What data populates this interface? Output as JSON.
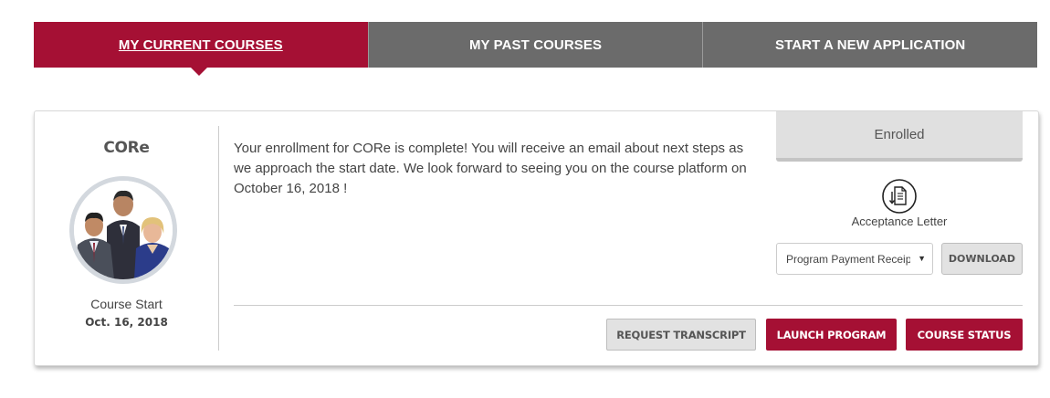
{
  "tabs": [
    {
      "label": "MY CURRENT COURSES",
      "active": true
    },
    {
      "label": "MY PAST COURSES",
      "active": false
    },
    {
      "label": "START A NEW APPLICATION",
      "active": false
    }
  ],
  "course": {
    "title": "CORe",
    "start_label": "Course Start",
    "start_date": "Oct. 16, 2018",
    "message": "Your enrollment for CORe is complete! You will receive an email about next steps as we approach the start date. We look forward to seeing you on the course platform on October 16, 2018 !",
    "status": "Enrolled",
    "acceptance_letter_label": "Acceptance Letter",
    "document_select": {
      "selected": "Program Payment Receipt",
      "caret": "▼"
    },
    "download_label": "DOWNLOAD",
    "buttons": {
      "request_transcript": "REQUEST TRANSCRIPT",
      "launch_program": "LAUNCH PROGRAM",
      "course_status": "COURSE STATUS"
    }
  },
  "colors": {
    "accent": "#a51034",
    "tab_inactive": "#6b6b6b",
    "status_bg": "#e0e0e0"
  },
  "icons": {
    "acceptance_letter": "document-download-icon",
    "select_caret": "caret-down-icon"
  }
}
